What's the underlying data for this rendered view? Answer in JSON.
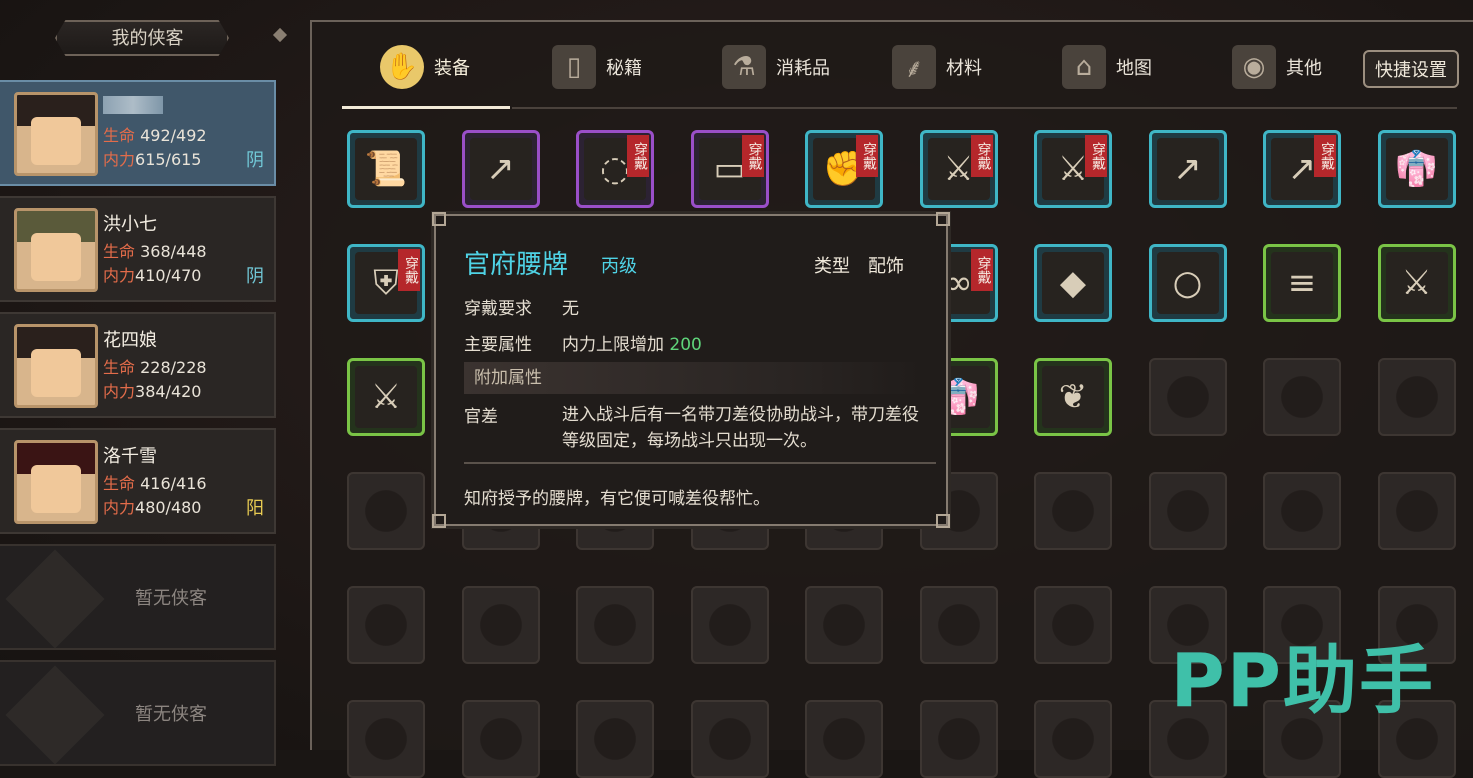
{
  "party": {
    "header": "我的侠客",
    "heroes": [
      {
        "name": "",
        "hp_label": "生命",
        "hp": "492/492",
        "mp_label": "内力",
        "mp": "615/615",
        "alignment": "阴",
        "alignment_type": "yin",
        "selected": true
      },
      {
        "name": "洪小七",
        "hp_label": "生命",
        "hp": "368/448",
        "mp_label": "内力",
        "mp": "410/470",
        "alignment": "阴",
        "alignment_type": "yin",
        "selected": false
      },
      {
        "name": "花四娘",
        "hp_label": "生命",
        "hp": "228/228",
        "mp_label": "内力",
        "mp": "384/420",
        "alignment": "",
        "alignment_type": "",
        "selected": false
      },
      {
        "name": "洛千雪",
        "hp_label": "生命",
        "hp": "416/416",
        "mp_label": "内力",
        "mp": "480/480",
        "alignment": "阳",
        "alignment_type": "yang",
        "selected": false
      }
    ],
    "empty_slots": [
      "暂无侠客",
      "暂无侠客"
    ]
  },
  "tabs": [
    {
      "label": "装备",
      "icon": "equipment-icon",
      "active": true
    },
    {
      "label": "秘籍",
      "icon": "manual-book-icon",
      "active": false
    },
    {
      "label": "消耗品",
      "icon": "potion-icon",
      "active": false
    },
    {
      "label": "材料",
      "icon": "herb-root-icon",
      "active": false
    },
    {
      "label": "地图",
      "icon": "map-icon",
      "active": false
    },
    {
      "label": "其他",
      "icon": "misc-icon",
      "active": false
    }
  ],
  "quick_settings": "快捷设置",
  "worn_label": "穿戴",
  "grid_rows": [
    [
      {
        "rarity": "blue",
        "icon": "scroll-icon",
        "worn": false
      },
      {
        "rarity": "purple",
        "icon": "spear-icon",
        "worn": false
      },
      {
        "rarity": "purple",
        "icon": "jade-ring-icon",
        "worn": true
      },
      {
        "rarity": "purple",
        "icon": "waist-token-icon",
        "worn": true
      },
      {
        "rarity": "blue",
        "icon": "gauntlet-icon",
        "worn": true
      },
      {
        "rarity": "blue",
        "icon": "sword-icon",
        "worn": true
      },
      {
        "rarity": "blue",
        "icon": "sword-icon",
        "worn": true
      },
      {
        "rarity": "blue",
        "icon": "spear-icon",
        "worn": false
      },
      {
        "rarity": "blue",
        "icon": "spear-icon",
        "worn": true
      },
      {
        "rarity": "blue",
        "icon": "robe-icon",
        "worn": false
      }
    ],
    [
      {
        "rarity": "blue",
        "icon": "armor-icon",
        "worn": true
      },
      {
        "rarity": "blue",
        "icon": "armor-icon",
        "worn": false
      },
      {
        "rarity": "blue",
        "icon": "armor-icon",
        "worn": false
      },
      {
        "rarity": "blue",
        "icon": "armor-icon",
        "worn": true
      },
      {
        "rarity": "blue",
        "icon": "boots-icon",
        "worn": false
      },
      {
        "rarity": "blue",
        "icon": "prayer-beads-icon",
        "worn": true
      },
      {
        "rarity": "blue",
        "icon": "cloth-icon",
        "worn": false
      },
      {
        "rarity": "blue",
        "icon": "jade-bracelet-icon",
        "worn": false
      },
      {
        "rarity": "green",
        "icon": "bandage-icon",
        "worn": false
      },
      {
        "rarity": "green",
        "icon": "sword-icon",
        "worn": false
      }
    ],
    [
      {
        "rarity": "green",
        "icon": "sword-icon",
        "worn": false
      },
      {
        "rarity": "green",
        "icon": "spear-icon",
        "worn": false
      },
      {
        "rarity": "green",
        "icon": "spear-icon",
        "worn": false
      },
      {
        "rarity": "green",
        "icon": "robe-icon",
        "worn": false
      },
      {
        "rarity": "green",
        "icon": "armor-icon",
        "worn": false
      },
      {
        "rarity": "green",
        "icon": "robe-icon",
        "worn": false
      },
      {
        "rarity": "green",
        "icon": "herb-bundle-icon",
        "worn": false
      },
      {
        "rarity": "empty",
        "icon": "",
        "worn": false
      },
      {
        "rarity": "empty",
        "icon": "",
        "worn": false
      },
      {
        "rarity": "empty",
        "icon": "",
        "worn": false
      }
    ]
  ],
  "tooltip": {
    "title": "官府腰牌",
    "grade": "丙级",
    "type_label": "类型",
    "type_value": "配饰",
    "req_label": "穿戴要求",
    "req_value": "无",
    "main_label": "主要属性",
    "main_value": "内力上限增加",
    "main_amount": "200",
    "extra_header": "附加属性",
    "extra_name": "官差",
    "extra_desc": "进入战斗后有一名带刀差役协助战斗，带刀差役等级固定，每场战斗只出现一次。",
    "flavor": "知府授予的腰牌，有它便可喊差役帮忙。"
  },
  "watermark": "PP助手",
  "colors": {
    "blue": "#3fb6c6",
    "purple": "#9a4fc8",
    "green": "#7ac446",
    "worn": "#b5272b"
  }
}
